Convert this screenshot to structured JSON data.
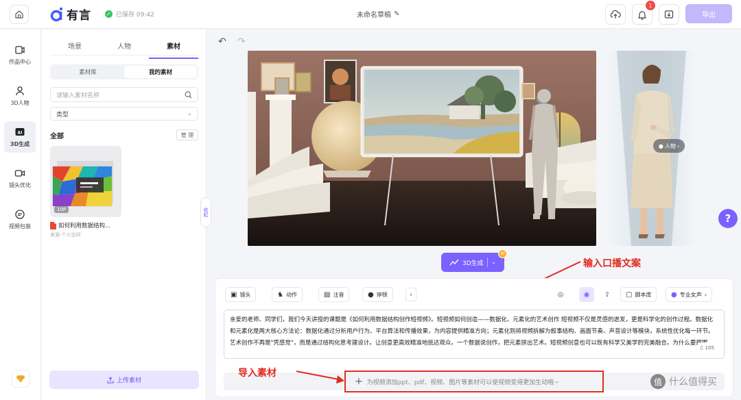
{
  "topbar": {
    "logo_text": "有言",
    "save_status": "已保存 09:42",
    "doc_title": "未命名草稿",
    "notification_count": "1",
    "export_label": "导出"
  },
  "nav": {
    "items": [
      {
        "label": "作品中心",
        "icon": "works-icon"
      },
      {
        "label": "3D人物",
        "icon": "person3d-icon"
      },
      {
        "label": "3D生成",
        "icon": "ai-generate-icon"
      },
      {
        "label": "镜头优化",
        "icon": "camera-optimize-icon"
      },
      {
        "label": "视频包装",
        "icon": "video-package-icon"
      }
    ]
  },
  "panel": {
    "tabs": [
      "场景",
      "人物",
      "素材"
    ],
    "segments": [
      "素材库",
      "我的素材"
    ],
    "search_placeholder": "请输入素材名称",
    "type_label": "类型",
    "all_label": "全部",
    "manage_label": "管 理",
    "asset": {
      "count": "10P",
      "name": "如何利用数据结构...",
      "source": "来源-个人空间"
    },
    "upload_label": "上传素材",
    "collapse_label": "收起"
  },
  "stage": {
    "person_button": "人物",
    "generate_label": "3D生成",
    "generate_badge": "AI"
  },
  "annotations": {
    "script_hint": "输入口播文案",
    "import_hint": "导入素材"
  },
  "editor": {
    "tools": [
      "镜头",
      "动作",
      "注音",
      "停顿"
    ],
    "script_library": "脚本库",
    "voice": "专业女声",
    "script_text": "亲爱的老师、同学们，我们今天讲授的课题是《如何利用数据结构创作短视频》。短视频如何创造——数据化、元素化的艺术创作 短视频不仅是灵感的迸发，更是科学化的创作过程。数据化和元素化是两大核心方法论：数据化通过分析用户行为、平台算法和传播效果，为内容提供精准方向；元素化则将视频拆解为叙事结构、画面节奏、声音设计等模块，系统性优化每一环节。艺术创作不再是\"凭感觉\"，而是通过结构化思考建设计。让创意更高效精准地抵达观众。一个数据说创作，把元素拼出艺术。短视频创意也可以既有科学又美学的完美融合。为什么要把握",
    "char_count": "105",
    "import_placeholder": "为视频添加ppt、pdf、视频、图片等素材可以使视频变得更加生动哦~"
  },
  "watermark": "什么值得买"
}
